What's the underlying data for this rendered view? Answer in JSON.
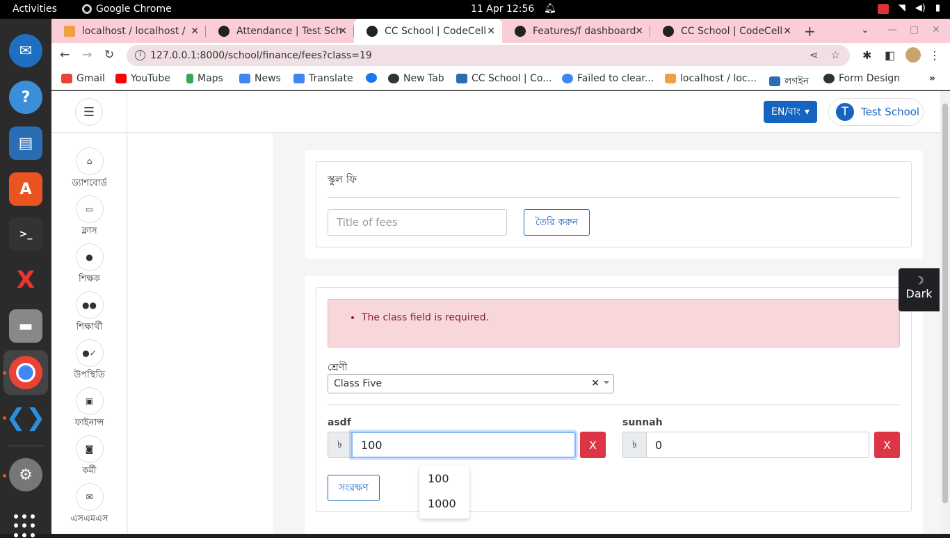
{
  "topbar": {
    "activities": "Activities",
    "app_name": "Google Chrome",
    "clock": "11 Apr  12:56"
  },
  "tabs": [
    {
      "title": "localhost / localhost / c",
      "active": false
    },
    {
      "title": "Attendance | Test School",
      "active": false
    },
    {
      "title": "CC School | CodeCell Ltd",
      "active": true
    },
    {
      "title": "Features/f dashboard",
      "active": false
    },
    {
      "title": "CC School | CodeCell Ltd",
      "active": false
    }
  ],
  "address_bar": {
    "url": "127.0.0.1:8000/school/finance/fees?class=19"
  },
  "bookmarks": [
    "Gmail",
    "YouTube",
    "Maps",
    "News",
    "Translate",
    "",
    "New Tab",
    "CC School | Co...",
    "Failed to clear...",
    "localhost / loc...",
    "লগইন",
    "Form Design"
  ],
  "header": {
    "lang_button": "EN/বাং",
    "user_initial": "T",
    "user_name": "Test School"
  },
  "sidebar": {
    "items": [
      {
        "label": "ড্যাশবোর্ড",
        "icon": "home-icon",
        "glyph": "⌂"
      },
      {
        "label": "ক্লাস",
        "icon": "class-icon",
        "glyph": "▭"
      },
      {
        "label": "শিক্ষক",
        "icon": "teacher-icon",
        "glyph": "●"
      },
      {
        "label": "শিক্ষার্থী",
        "icon": "students-icon",
        "glyph": "●●"
      },
      {
        "label": "উপস্থিতি",
        "icon": "attendance-icon",
        "glyph": "●✓"
      },
      {
        "label": "ফাইনান্স",
        "icon": "finance-icon",
        "glyph": "▣"
      },
      {
        "label": "কর্মী",
        "icon": "staff-icon",
        "glyph": "◙"
      },
      {
        "label": "এসএমএস",
        "icon": "sms-icon",
        "glyph": "✉"
      }
    ]
  },
  "fee_card": {
    "title": "স্কুল ফি",
    "title_placeholder": "Title of fees",
    "create_button": "তৈরি করুন"
  },
  "form_card": {
    "error": "The class field is required.",
    "class_label": "শ্রেণী",
    "class_value": "Class Five",
    "currency": "৳",
    "fees": [
      {
        "name": "asdf",
        "value": "100"
      },
      {
        "name": "sunnah",
        "value": "0"
      }
    ],
    "remove_label": "X",
    "save_button": "সংরক্ষণ",
    "autocomplete": [
      "100",
      "1000"
    ]
  },
  "dark_toggle": {
    "icon": "moon-icon",
    "label": "Dark"
  },
  "colors": {
    "tabstrip": "#fbcdd7",
    "primary": "#1565c0",
    "danger": "#dc3545",
    "alert_bg": "#f8d7da"
  }
}
